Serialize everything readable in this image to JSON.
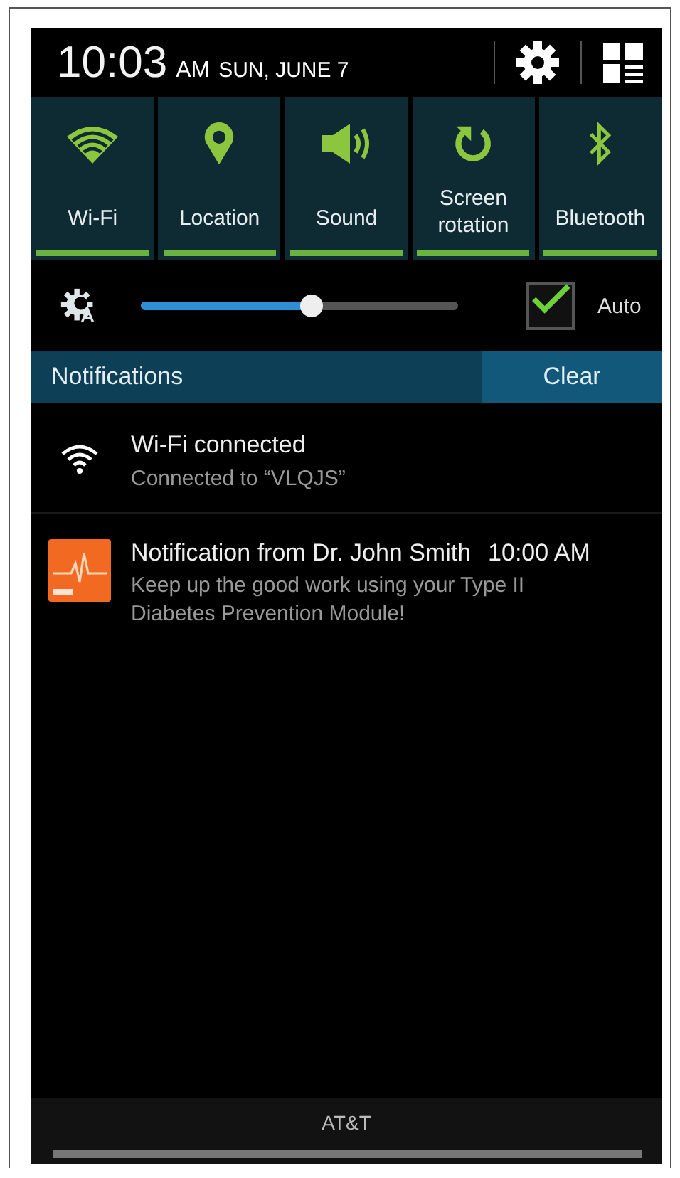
{
  "status_header": {
    "time": "10:03",
    "ampm": "AM",
    "date": "SUN, JUNE 7"
  },
  "quick_settings": [
    {
      "kind": "wifi",
      "label": "Wi-Fi",
      "on": true
    },
    {
      "kind": "location",
      "label": "Location",
      "on": true
    },
    {
      "kind": "sound",
      "label": "Sound",
      "on": true
    },
    {
      "kind": "rotation",
      "label": "Screen rotation",
      "on": true
    },
    {
      "kind": "bluetooth",
      "label": "Bluetooth",
      "on": true
    }
  ],
  "brightness": {
    "level": 0.54,
    "auto_label": "Auto",
    "auto_checked": true
  },
  "notifications_bar": {
    "title": "Notifications",
    "clear": "Clear"
  },
  "notifications": [
    {
      "kind": "wifi",
      "title": "Wi-Fi connected",
      "text": "Connected to “VLQJS”"
    },
    {
      "kind": "app",
      "title": "Notification from Dr. John Smith",
      "time": "10:00 AM",
      "text": "Keep up the good work using your Type II Diabetes Prevention Module!"
    }
  ],
  "carrier": "AT&T"
}
